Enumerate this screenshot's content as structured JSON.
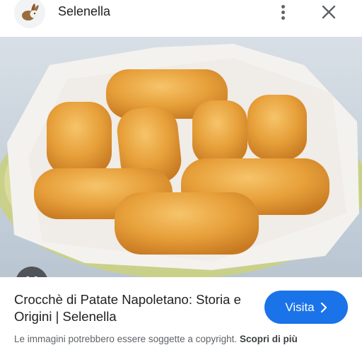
{
  "header": {
    "site_name": "Selenella",
    "logo_icon": "selenella-rabbit-logo",
    "more_icon": "more-vert-icon",
    "close_icon": "close-icon"
  },
  "image": {
    "subject": "crocchè di patate",
    "lens_icon": "google-lens-icon"
  },
  "result": {
    "title": "Crocchè di Patate Napoletano: Storia e Origini | Selenella",
    "visit_label": "Visita",
    "copyright_text": "Le immagini potrebbero essere soggette a copyright.",
    "more_info_label": "Scopri di più"
  },
  "colors": {
    "accent": "#1a73e8",
    "text_primary": "#202124",
    "text_secondary": "#5f6368"
  }
}
